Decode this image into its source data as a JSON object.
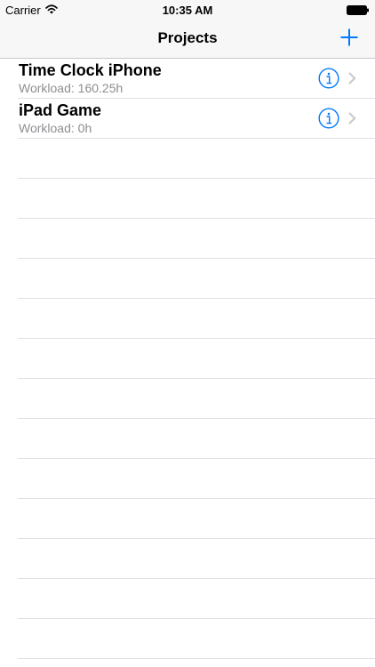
{
  "status_bar": {
    "carrier": "Carrier",
    "time": "10:35 AM",
    "wifi_icon": "wifi-icon",
    "battery_icon": "battery-icon"
  },
  "nav_bar": {
    "title": "Projects",
    "add_icon": "plus-icon"
  },
  "projects": [
    {
      "name": "Time Clock iPhone",
      "workload": "Workload: 160.25h"
    },
    {
      "name": "iPad Game",
      "workload": "Workload: 0h"
    }
  ],
  "colors": {
    "accent": "#007aff",
    "nav_background": "#f7f7f7",
    "subtitle": "#8e8e93",
    "separator": "#e0e0e4",
    "chevron": "#c7c7cc"
  }
}
